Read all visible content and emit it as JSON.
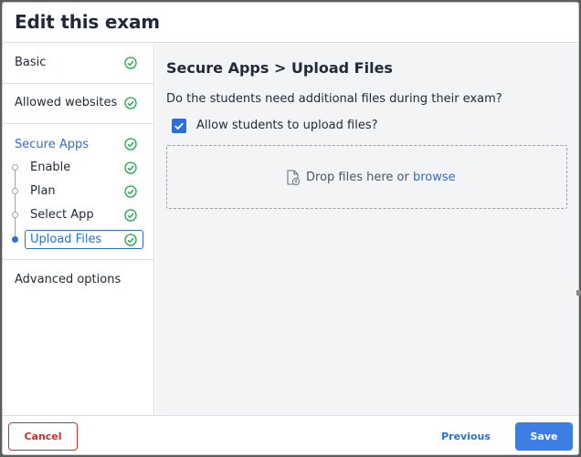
{
  "dialog": {
    "title": "Edit this exam"
  },
  "sidebar": {
    "items": [
      {
        "label": "Basic"
      },
      {
        "label": "Allowed websites"
      },
      {
        "label": "Secure Apps"
      },
      {
        "label": "Advanced options"
      }
    ],
    "sub_items": [
      {
        "label": "Enable"
      },
      {
        "label": "Plan"
      },
      {
        "label": "Select App"
      },
      {
        "label": "Upload Files"
      }
    ],
    "active_sub": "Upload Files",
    "check_color": "#22a447",
    "accent_color": "#2d6fd6"
  },
  "main": {
    "heading": "Secure Apps > Upload Files",
    "question": "Do the students need additional files during their exam?",
    "checkbox": {
      "label": "Allow students to upload files?",
      "checked": true
    },
    "dropzone": {
      "text": "Drop files here or ",
      "link": "browse"
    }
  },
  "footer": {
    "cancel_label": "Cancel",
    "previous_label": "Previous",
    "save_label": "Save"
  }
}
